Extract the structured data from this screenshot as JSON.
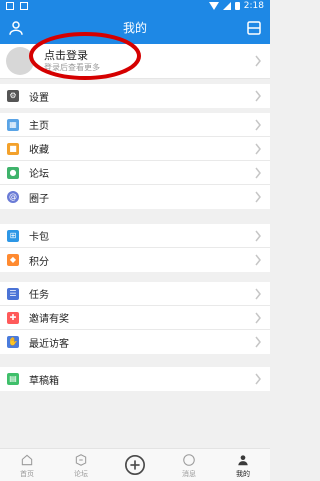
{
  "status_bar": {
    "time": "2:18"
  },
  "header": {
    "title": "我的"
  },
  "login": {
    "title": "点击登录",
    "subtitle": "登录后查看更多"
  },
  "colors": {
    "primary": "#1e88e5",
    "settings": "#555555",
    "home": "#5aa4e6",
    "favorites": "#f3a12b",
    "forum": "#3fb36b",
    "circle": "#6a7bd6",
    "card": "#2d97e6",
    "points": "#ff8a30",
    "tasks": "#4b73d6",
    "invite": "#ff5a5a",
    "visitors": "#4a7bdc",
    "drafts": "#3fbf6a"
  },
  "menu": {
    "groups": [
      [
        {
          "label": "设置",
          "icon": "gear-icon"
        }
      ],
      [
        {
          "label": "主页",
          "icon": "home-image-icon"
        },
        {
          "label": "收藏",
          "icon": "box-icon"
        },
        {
          "label": "论坛",
          "icon": "chat-icon"
        },
        {
          "label": "圈子",
          "icon": "at-icon"
        }
      ],
      [
        {
          "label": "卡包",
          "icon": "windows-icon"
        },
        {
          "label": "积分",
          "icon": "points-icon"
        }
      ],
      [
        {
          "label": "任务",
          "icon": "task-icon"
        },
        {
          "label": "邀请有奖",
          "icon": "gift-icon"
        },
        {
          "label": "最近访客",
          "icon": "visitor-icon"
        }
      ],
      [
        {
          "label": "草稿箱",
          "icon": "draft-icon"
        }
      ]
    ]
  },
  "tabbar": {
    "items": [
      {
        "label": "首页",
        "icon": "home-icon"
      },
      {
        "label": "论坛",
        "icon": "forum-icon"
      },
      {
        "label": "",
        "icon": "plus-icon"
      },
      {
        "label": "消息",
        "icon": "message-icon"
      },
      {
        "label": "我的",
        "icon": "profile-icon"
      }
    ]
  }
}
